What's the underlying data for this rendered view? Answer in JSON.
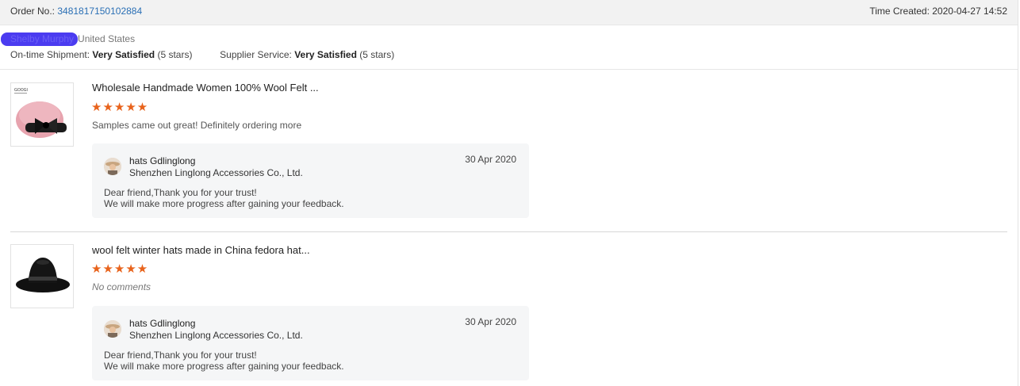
{
  "order": {
    "label": "Order No.:",
    "number": "3481817150102884",
    "time_created": "Time Created: 2020-04-27 14:52"
  },
  "buyer": {
    "name": "Shelby Murphy",
    "country": "United States"
  },
  "ratings": {
    "shipment_label": "On-time Shipment:",
    "shipment_value": "Very Satisfied",
    "shipment_stars": "(5 stars)",
    "service_label": "Supplier Service:",
    "service_value": "Very Satisfied",
    "service_stars": "(5 stars)"
  },
  "items": [
    {
      "title": "Wholesale Handmade Women 100% Wool Felt ...",
      "stars": "★★★★★",
      "rating": 5,
      "comment": "Samples came out great! Definitely ordering more",
      "reply": {
        "seller": "hats Gdlinglong",
        "company": "Shenzhen Linglong Accessories Co., Ltd.",
        "date": "30 Apr 2020",
        "line1": "Dear friend,Thank you for your trust!",
        "line2": "We will make more progress after gaining your feedback."
      }
    },
    {
      "title": "wool felt winter hats made in China fedora hat...",
      "stars": "★★★★★",
      "rating": 5,
      "comment": "No comments",
      "reply": {
        "seller": "hats Gdlinglong",
        "company": "Shenzhen Linglong Accessories Co., Ltd.",
        "date": "30 Apr 2020",
        "line1": "Dear friend,Thank you for your trust!",
        "line2": "We will make more progress after gaining your feedback."
      }
    }
  ],
  "colors": {
    "star": "#e8631c",
    "link": "#2a6fb5",
    "redaction": "#4b3cf0"
  }
}
